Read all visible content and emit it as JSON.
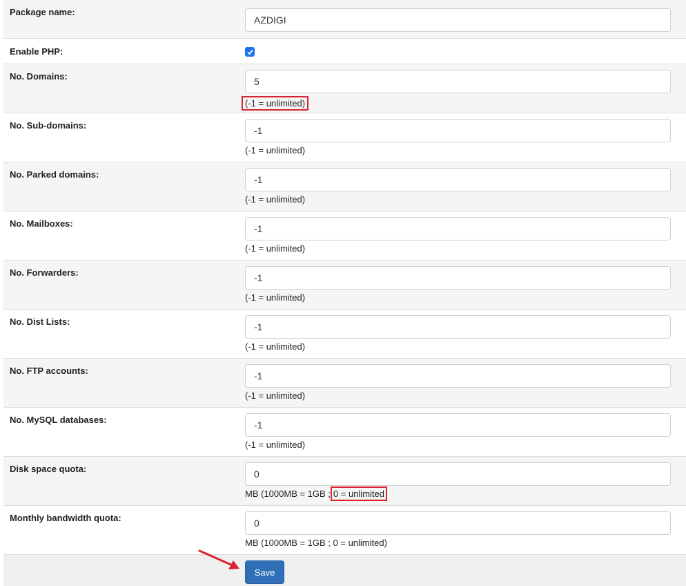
{
  "form": {
    "rows": [
      {
        "label": "Package name:",
        "type": "text",
        "value": "AZDIGI"
      },
      {
        "label": "Enable PHP:",
        "type": "checkbox",
        "checked": true
      },
      {
        "label": "No. Domains:",
        "type": "text",
        "value": "5",
        "hint": "(-1 = unlimited)",
        "hint_highlighted": true
      },
      {
        "label": "No. Sub-domains:",
        "type": "text",
        "value": "-1",
        "hint": "(-1 = unlimited)"
      },
      {
        "label": "No. Parked domains:",
        "type": "text",
        "value": "-1",
        "hint": "(-1 = unlimited)"
      },
      {
        "label": "No. Mailboxes:",
        "type": "text",
        "value": "-1",
        "hint": "(-1 = unlimited)"
      },
      {
        "label": "No. Forwarders:",
        "type": "text",
        "value": "-1",
        "hint": "(-1 = unlimited)"
      },
      {
        "label": "No. Dist Lists:",
        "type": "text",
        "value": "-1",
        "hint": "(-1 = unlimited)"
      },
      {
        "label": "No. FTP accounts:",
        "type": "text",
        "value": "-1",
        "hint": "(-1 = unlimited)"
      },
      {
        "label": "No. MySQL databases:",
        "type": "text",
        "value": "-1",
        "hint": "(-1 = unlimited)"
      },
      {
        "label": "Disk space quota:",
        "type": "text",
        "value": "0",
        "hint_prefix": "MB (1000MB = 1GB ;",
        "hint_highlight": "0 = unlimited"
      },
      {
        "label": "Monthly bandwidth quota:",
        "type": "text",
        "value": "0",
        "hint": "MB (1000MB = 1GB ; 0 = unlimited)"
      }
    ],
    "save_label": "Save"
  },
  "colors": {
    "accent": "#2f6fb8",
    "annotation": "#d9232d",
    "checkbox": "#1a73e8"
  },
  "icons": {
    "checkbox": "check-icon",
    "annotation": "red-arrow-icon"
  }
}
